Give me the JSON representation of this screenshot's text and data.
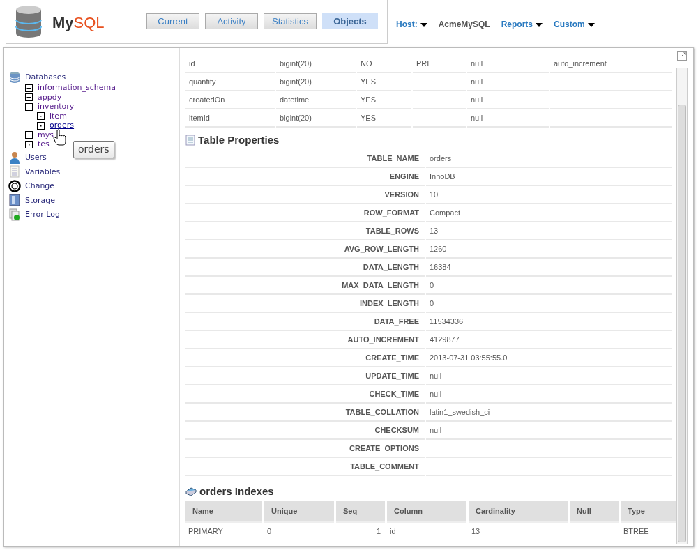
{
  "logo": {
    "brand_dark": "My",
    "brand_light": "SQL"
  },
  "tabs": [
    {
      "label": "Current",
      "selected": false
    },
    {
      "label": "Activity",
      "selected": false
    },
    {
      "label": "Statistics",
      "selected": false
    },
    {
      "label": "Objects",
      "selected": true
    }
  ],
  "host": {
    "label": "Host:",
    "value": "AcmeMySQL"
  },
  "menus": [
    "Reports",
    "Custom"
  ],
  "sidebar": {
    "items": [
      {
        "label": "Databases",
        "kind": "database",
        "children": [
          {
            "label": "information_schema",
            "kind": "plus"
          },
          {
            "label": "appdy",
            "kind": "plus"
          },
          {
            "label": "inventory",
            "kind": "minus",
            "children": [
              {
                "label": "item",
                "kind": "dot",
                "hovered": false
              },
              {
                "label": "orders",
                "kind": "dot",
                "hovered": true
              }
            ]
          },
          {
            "label": "mys",
            "kind": "plus"
          },
          {
            "label": "tes",
            "kind": "dot"
          }
        ]
      },
      {
        "label": "Users",
        "kind": "user"
      },
      {
        "label": "Variables",
        "kind": "list"
      },
      {
        "label": "Change",
        "kind": "ring"
      },
      {
        "label": "Storage",
        "kind": "storage"
      },
      {
        "label": "Error Log",
        "kind": "log"
      }
    ]
  },
  "tooltip": "orders",
  "columns_table": {
    "rows": [
      [
        "id",
        "bigint(20)",
        "NO",
        "PRI",
        "null",
        "auto_increment"
      ],
      [
        "quantity",
        "bigint(20)",
        "YES",
        "",
        "null",
        ""
      ],
      [
        "createdOn",
        "datetime",
        "YES",
        "",
        "null",
        ""
      ],
      [
        "itemId",
        "bigint(20)",
        "YES",
        "",
        "null",
        ""
      ]
    ]
  },
  "properties": {
    "title": "Table Properties",
    "rows": [
      {
        "name": "TABLE_NAME",
        "value": "orders"
      },
      {
        "name": "ENGINE",
        "value": "InnoDB"
      },
      {
        "name": "VERSION",
        "value": "10"
      },
      {
        "name": "ROW_FORMAT",
        "value": "Compact"
      },
      {
        "name": "TABLE_ROWS",
        "value": "13"
      },
      {
        "name": "AVG_ROW_LENGTH",
        "value": "1260"
      },
      {
        "name": "DATA_LENGTH",
        "value": "16384"
      },
      {
        "name": "MAX_DATA_LENGTH",
        "value": "0"
      },
      {
        "name": "INDEX_LENGTH",
        "value": "0"
      },
      {
        "name": "DATA_FREE",
        "value": "11534336"
      },
      {
        "name": "AUTO_INCREMENT",
        "value": "4129877"
      },
      {
        "name": "CREATE_TIME",
        "value": "2013-07-31 03:55:55.0"
      },
      {
        "name": "UPDATE_TIME",
        "value": "null"
      },
      {
        "name": "CHECK_TIME",
        "value": "null"
      },
      {
        "name": "TABLE_COLLATION",
        "value": "latin1_swedish_ci"
      },
      {
        "name": "CHECKSUM",
        "value": "null"
      },
      {
        "name": "CREATE_OPTIONS",
        "value": ""
      },
      {
        "name": "TABLE_COMMENT",
        "value": ""
      }
    ]
  },
  "indexes": {
    "title": "orders Indexes",
    "columns": [
      "Name",
      "Unique",
      "Seq",
      "Column",
      "Cardinality",
      "Null",
      "Type"
    ],
    "rows": [
      [
        "PRIMARY",
        "0",
        "1",
        "id",
        "13",
        "",
        "BTREE"
      ]
    ]
  }
}
